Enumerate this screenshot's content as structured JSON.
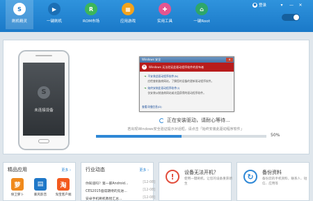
{
  "header": {
    "nav": [
      {
        "label": "刷机精灵",
        "symbol": "S",
        "color": "#ffffff",
        "text_color": "#1a79c8"
      },
      {
        "label": "一键刷机",
        "symbol": "▶",
        "color": "#1b6fb5",
        "text_color": "#ffffff"
      },
      {
        "label": "ROM市场",
        "symbol": "R",
        "color": "#3cb65b",
        "text_color": "#ffffff"
      },
      {
        "label": "应用游戏",
        "symbol": "▦",
        "color": "#f2a21b",
        "text_color": "#ffffff"
      },
      {
        "label": "实用工具",
        "symbol": "✚",
        "color": "#e45590",
        "text_color": "#ffffff"
      },
      {
        "label": "一键Root",
        "symbol": "⌂",
        "color": "#2ea66a",
        "text_color": "#ffffff"
      }
    ],
    "login_label": "登录",
    "window_controls": [
      "▾",
      "—",
      "✕"
    ]
  },
  "phone": {
    "status": "未连接设备"
  },
  "dialog": {
    "title": "Windows 安全",
    "banner": "Windows 无法验证此驱动程序软件的发布者",
    "options": [
      {
        "title": "不安装此驱动程序软件(N)",
        "desc": "应检查制造商网站，了解您的设备的更新驱动程序软件。"
      },
      {
        "title": "始终安装此驱动程序软件(I)",
        "desc": "仅安装从制造商网站或光盘获得的驱动程序软件。"
      }
    ],
    "footer": "查看详细信息(D)"
  },
  "install": {
    "status": "正在安装驱动，请耐心等待...",
    "hint": "若出现Windows安全验证提示对话框，请点击「始终安装此驱动程序软件」",
    "progress_percent": 50,
    "percent_label": "50%"
  },
  "cards": {
    "apps": {
      "title": "精品应用",
      "more": "更多 ›",
      "items": [
        {
          "name": "保卫萝卜",
          "color": "#f08a1c",
          "symbol": "萝"
        },
        {
          "name": "暴风影音",
          "color": "#1f78c8",
          "symbol": "▤"
        },
        {
          "name": "淘宝客户端",
          "color": "#f35a1e",
          "symbol": "淘"
        }
      ]
    },
    "news": {
      "title": "行业动态",
      "more": "更多 ›",
      "items": [
        {
          "text": "你知道吗？第一部Android...",
          "size": "[12-08]"
        },
        {
          "text": "CES2015值得期待的先进...",
          "size": "[12-08]"
        },
        {
          "text": "安卓手机刷机教程汇总...",
          "size": "[12-08]"
        }
      ]
    },
    "tools": [
      {
        "title": "设备无法开机？",
        "desc": "使用一键刷机，让您的设备重获新生",
        "symbol": "!",
        "color": "#e24d3c"
      },
      {
        "title": "备份资料",
        "desc": "备份您的手机资料，联系人、短信、应用等",
        "symbol": "↻",
        "color": "#2f88d6"
      }
    ]
  }
}
